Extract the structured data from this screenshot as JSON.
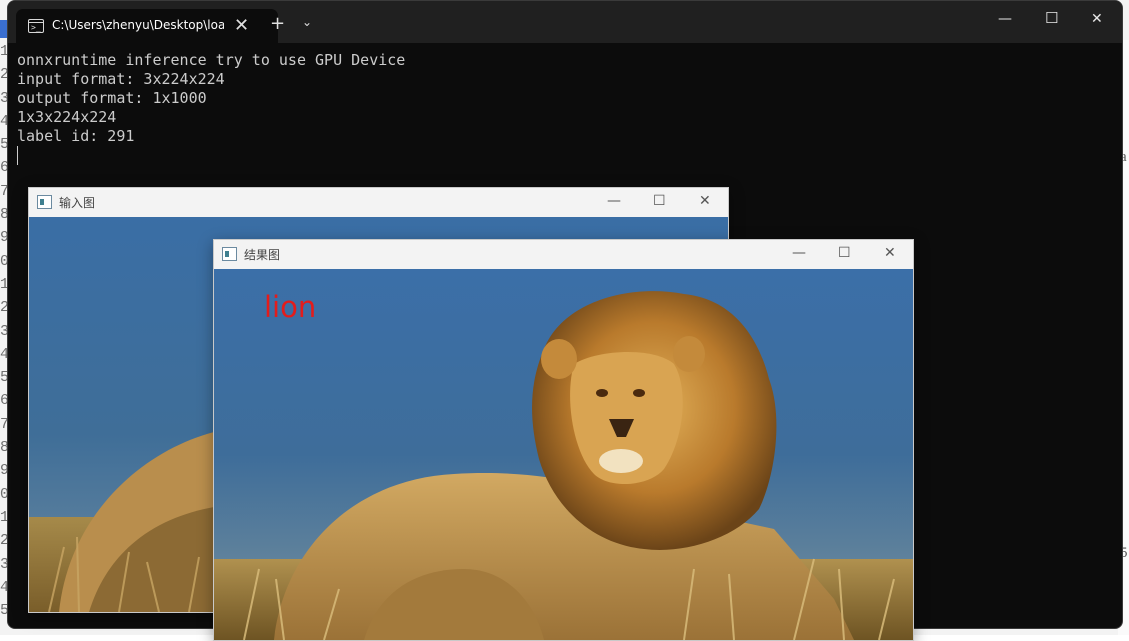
{
  "terminal": {
    "tab_title": "C:\\Users\\zhenyu\\Desktop\\loac",
    "tab_close": "✕",
    "new_tab": "+",
    "dropdown": "⌄",
    "minimize": "—",
    "maximize": "☐",
    "close": "✕",
    "lines": [
      "onnxruntime inference try to use GPU Device",
      "input format: 3x224x224",
      "output format: 1x1000",
      "1x3x224x224",
      "label id: 291"
    ]
  },
  "input_window": {
    "title": "输入图",
    "minimize": "—",
    "maximize": "☐",
    "close": "✕"
  },
  "result_window": {
    "title": "结果图",
    "minimize": "—",
    "maximize": "☐",
    "close": "✕",
    "prediction_label": "lion",
    "prediction_color": "#e31c1c"
  },
  "background": {
    "gutter_numbers": [
      "1",
      "2",
      "3",
      "4",
      "5",
      "6",
      "7",
      "8",
      "9",
      "0",
      "1",
      "2",
      "3",
      "4",
      "5",
      "6",
      "7",
      "8",
      "9",
      "0",
      "1",
      "2",
      "3",
      "4",
      "5"
    ],
    "right_chars": [
      "a",
      "5"
    ]
  },
  "colors": {
    "terminal_bg": "#0c0c0c",
    "terminal_text": "#cccccc",
    "sky": "#3d6fa3",
    "grass": "#9a7d3c"
  }
}
